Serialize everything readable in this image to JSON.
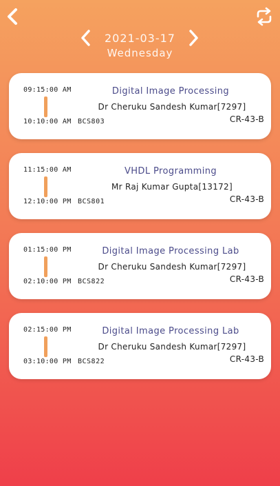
{
  "header": {
    "back_icon": "chevron-left-icon",
    "refresh_icon": "refresh-icon",
    "date": "2021-03-17",
    "day": "Wednesday",
    "prev_icon": "chevron-left-icon",
    "next_icon": "chevron-right-icon"
  },
  "classes": [
    {
      "start": "09:15:00 AM",
      "end": "10:10:00 AM",
      "code": "BCS803",
      "subject": "Digital Image Processing",
      "teacher": "Dr Cheruku Sandesh Kumar[7297]",
      "room": "CR-43-B"
    },
    {
      "start": "11:15:00 AM",
      "end": "12:10:00 PM",
      "code": "BCS801",
      "subject": "VHDL Programming",
      "teacher": "Mr Raj Kumar Gupta[13172]",
      "room": "CR-43-B"
    },
    {
      "start": "01:15:00 PM",
      "end": "02:10:00 PM",
      "code": "BCS822",
      "subject": "Digital Image Processing Lab",
      "teacher": "Dr Cheruku Sandesh Kumar[7297]",
      "room": "CR-43-B"
    },
    {
      "start": "02:15:00 PM",
      "end": "03:10:00 PM",
      "code": "BCS822",
      "subject": "Digital Image Processing Lab",
      "teacher": "Dr Cheruku Sandesh Kumar[7297]",
      "room": "CR-43-B"
    }
  ],
  "colors": {
    "gradient_top": "#f5a25f",
    "gradient_bottom": "#ef3f4a",
    "subject_text": "#4b4b8a",
    "time_bar": "#f0a05c"
  }
}
